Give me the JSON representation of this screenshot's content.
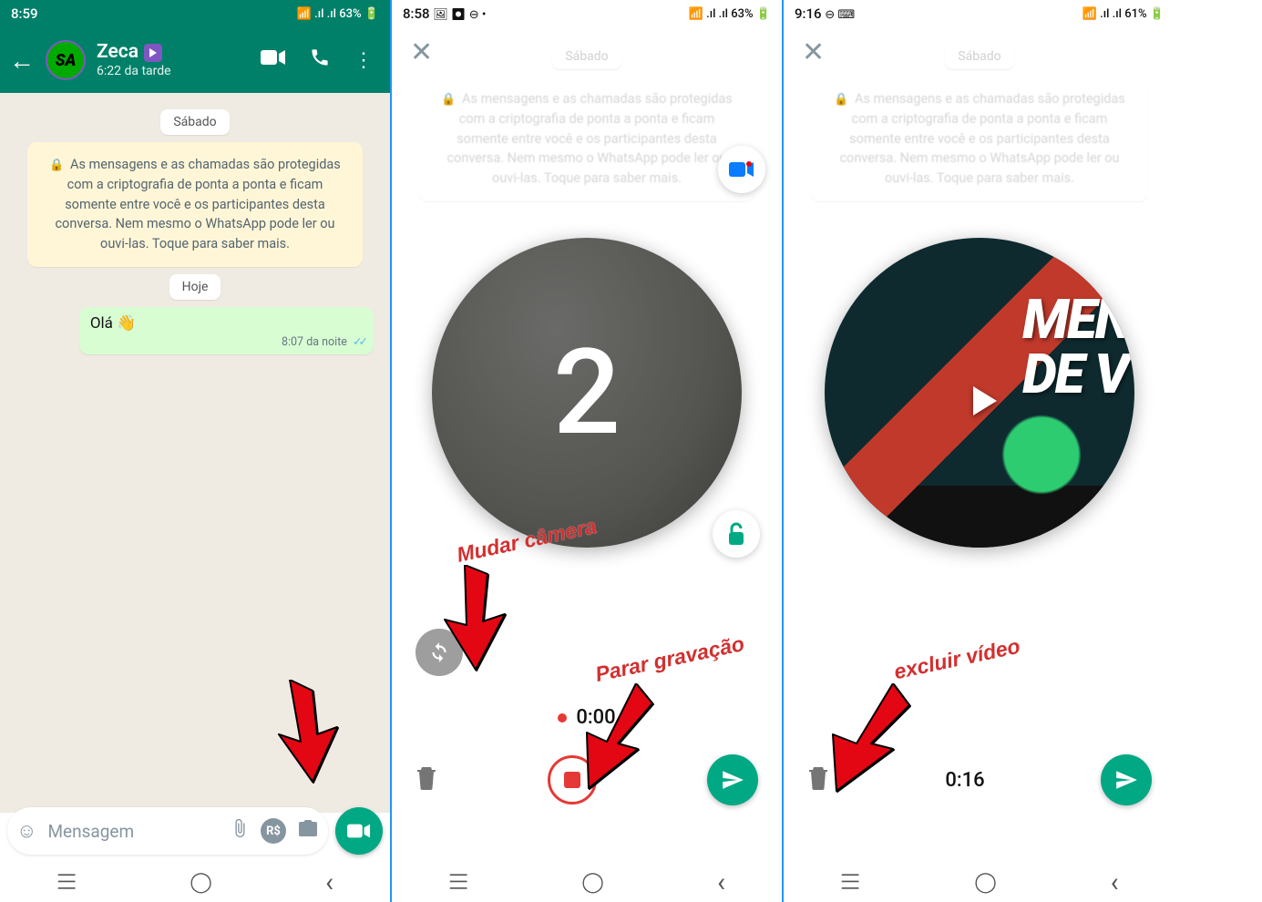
{
  "colors": {
    "wa_primary": "#008069",
    "wa_accent": "#00a884",
    "anno_red": "#d32f2f"
  },
  "screen1": {
    "status": {
      "time": "8:59",
      "icons": "⊖ ⌨",
      "right": "📶 .ıl .ıl 63% 🔋"
    },
    "contact": {
      "name": "Zeca",
      "sub": "6:22 da tarde"
    },
    "day_label1": "Sábado",
    "encryption": "As mensagens e as chamadas são protegidas com a criptografia de ponta a ponta e ficam somente entre você e os participantes desta conversa. Nem mesmo o WhatsApp pode ler ou ouvi-las. Toque para saber mais.",
    "day_label2": "Hoje",
    "msg": {
      "text": "Olá 👋",
      "time": "8:07 da noite"
    },
    "compose_placeholder": "Mensagem"
  },
  "screen2": {
    "status": {
      "time": "8:58",
      "icons": "🖼 ⏺ ⊖ •",
      "right": "📶 .ıl .ıl 63% 🔋"
    },
    "day_label": "Sábado",
    "encryption": "As mensagens e as chamadas são protegidas com a criptografia de ponta a ponta e ficam somente entre você e os participantes desta conversa. Nem mesmo o WhatsApp pode ler ou ouvi-las. Toque para saber mais.",
    "countdown": "2",
    "timer": "0:00",
    "anno": {
      "switch_camera": "Mudar câmera",
      "stop_recording": "Parar gravação"
    }
  },
  "screen3": {
    "status": {
      "time": "9:16",
      "icons": "⊖ ⌨",
      "right": "📶 .ıl .ıl 61% 🔋"
    },
    "day_label": "Sábado",
    "encryption": "As mensagens e as chamadas são protegidas com a criptografia de ponta a ponta e ficam somente entre você e os participantes desta conversa. Nem mesmo o WhatsApp pode ler ou ouvi-las. Toque para saber mais.",
    "video_overlay_line1": "MENS",
    "video_overlay_line2": "DE V",
    "duration": "0:16",
    "anno": {
      "delete_video": "excluir vídeo"
    }
  },
  "nav_icons": {
    "recents": "|||",
    "home": "◯",
    "back": "‹"
  }
}
